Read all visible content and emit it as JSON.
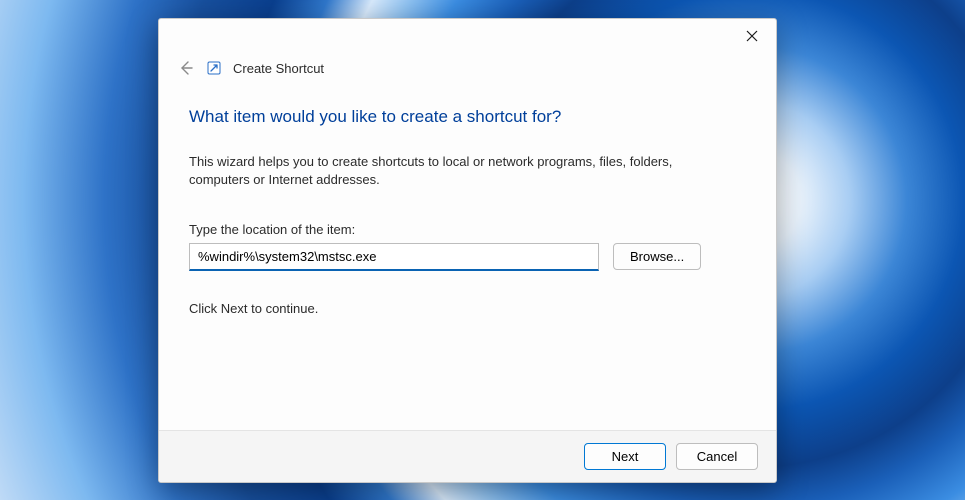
{
  "header": {
    "window_title": "Create Shortcut"
  },
  "content": {
    "heading": "What item would you like to create a shortcut for?",
    "description": "This wizard helps you to create shortcuts to local or network programs, files, folders, computers or Internet addresses.",
    "location_label": "Type the location of the item:",
    "location_value": "%windir%\\system32\\mstsc.exe",
    "browse_label": "Browse...",
    "continue_text": "Click Next to continue."
  },
  "footer": {
    "next_label": "Next",
    "cancel_label": "Cancel"
  }
}
